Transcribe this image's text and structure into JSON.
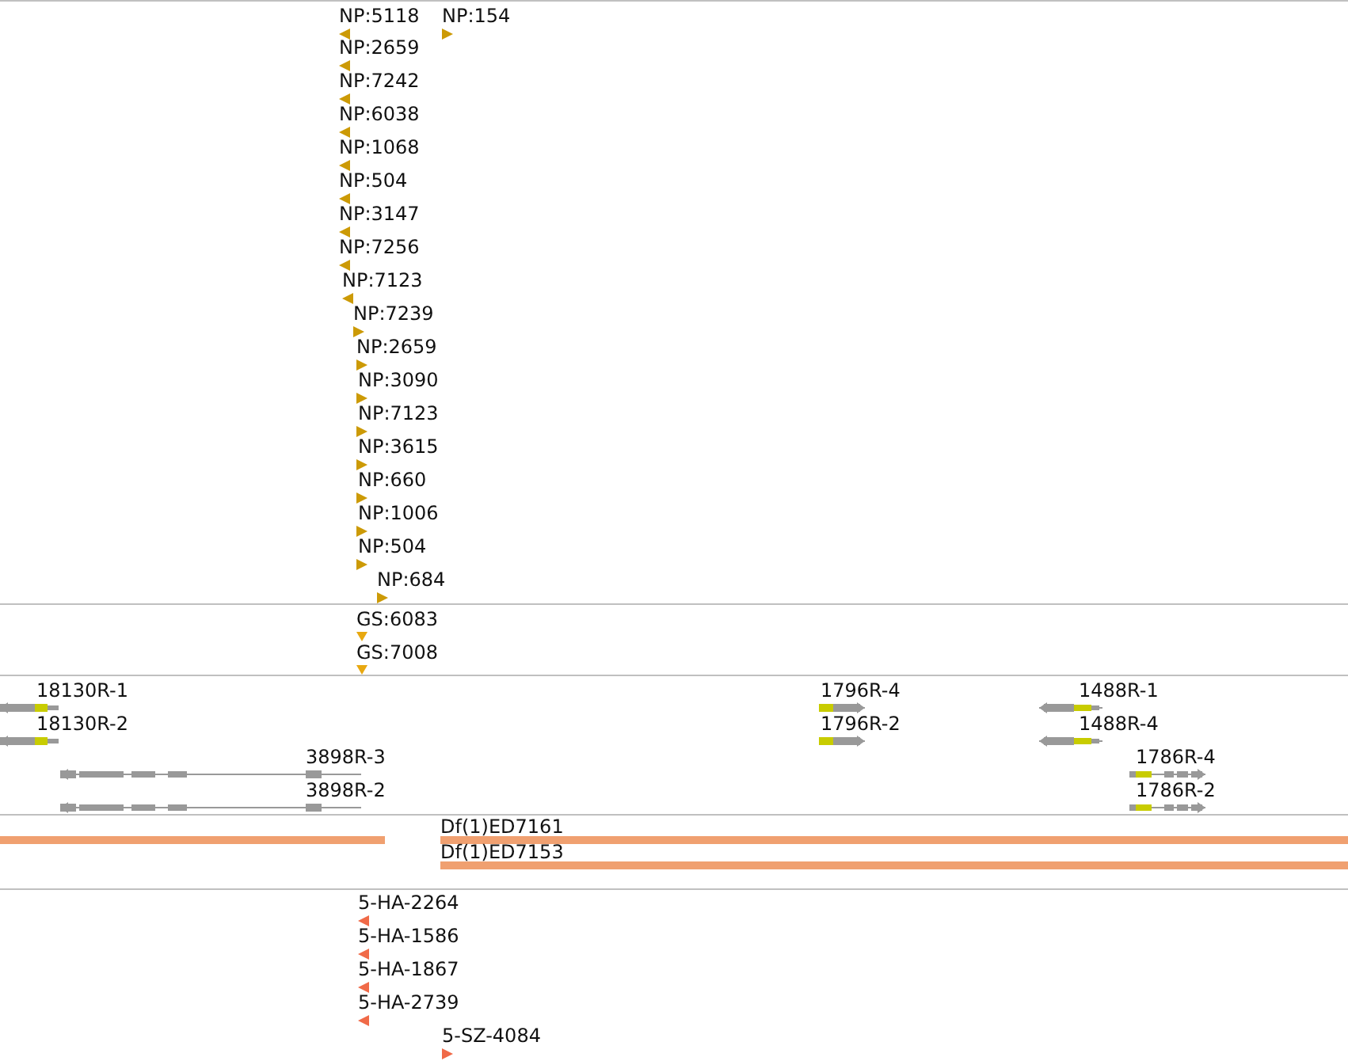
{
  "tracks": [
    {
      "kind": "insertions",
      "color": "#cc9a06",
      "features": [
        {
          "label": "NP:5118",
          "reverse": true
        },
        {
          "label": "NP:154",
          "reverse": false
        },
        {
          "label": "NP:2659",
          "reverse": true
        },
        {
          "label": "NP:7242",
          "reverse": true
        },
        {
          "label": "NP:6038",
          "reverse": true
        },
        {
          "label": "NP:1068",
          "reverse": true
        },
        {
          "label": "NP:504",
          "reverse": true
        },
        {
          "label": "NP:3147",
          "reverse": true
        },
        {
          "label": "NP:7256",
          "reverse": true
        },
        {
          "label": "NP:7123",
          "reverse": true
        },
        {
          "label": "NP:7239",
          "reverse": false
        },
        {
          "label": "NP:2659",
          "reverse": false
        },
        {
          "label": "NP:3090",
          "reverse": false
        },
        {
          "label": "NP:7123",
          "reverse": false
        },
        {
          "label": "NP:3615",
          "reverse": false
        },
        {
          "label": "NP:660",
          "reverse": false
        },
        {
          "label": "NP:1006",
          "reverse": false
        },
        {
          "label": "NP:504",
          "reverse": false
        },
        {
          "label": "NP:684",
          "reverse": false
        }
      ]
    },
    {
      "kind": "unoriented",
      "color": "#e8a810",
      "features": [
        {
          "label": "GS:6083"
        },
        {
          "label": "GS:7008"
        }
      ]
    },
    {
      "kind": "genes",
      "color": "#999999",
      "features": [
        {
          "label": "18130R-1",
          "reverse": true
        },
        {
          "label": "18130R-2",
          "reverse": true
        },
        {
          "label": "3898R-3",
          "reverse": true
        },
        {
          "label": "3898R-2",
          "reverse": true
        },
        {
          "label": "1796R-4",
          "reverse": false
        },
        {
          "label": "1796R-2",
          "reverse": false
        },
        {
          "label": "1488R-1",
          "reverse": true
        },
        {
          "label": "1488R-4",
          "reverse": true
        },
        {
          "label": "1786R-4",
          "reverse": false
        },
        {
          "label": "1786R-2",
          "reverse": false
        }
      ]
    },
    {
      "kind": "deletions",
      "color": "#f0a070",
      "features": [
        {
          "label": "Df(1)ED7161"
        },
        {
          "label": "Df(1)ED7153"
        }
      ]
    },
    {
      "kind": "insertions",
      "color": "#f06a48",
      "features": [
        {
          "label": "5-HA-2264",
          "reverse": true
        },
        {
          "label": "5-HA-1586",
          "reverse": true
        },
        {
          "label": "5-HA-1867",
          "reverse": true
        },
        {
          "label": "5-HA-2739",
          "reverse": true
        },
        {
          "label": "5-SZ-4084",
          "reverse": false
        }
      ]
    }
  ]
}
